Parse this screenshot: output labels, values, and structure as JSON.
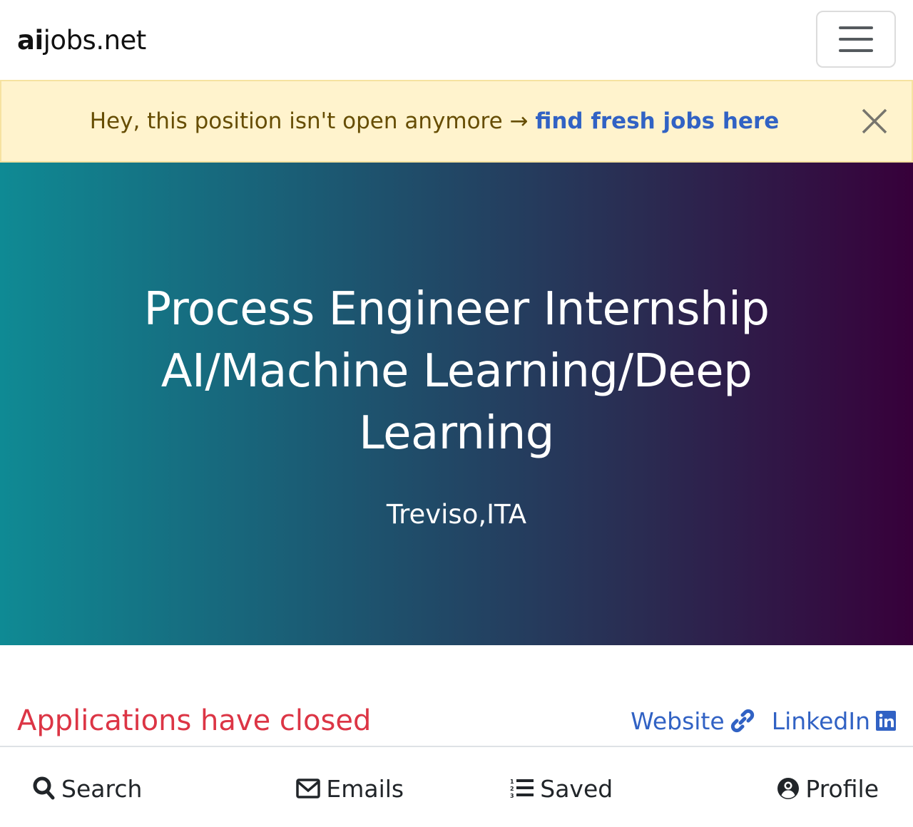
{
  "navbar": {
    "brand_bold": "ai",
    "brand_rest": "jobs.net",
    "menu_toggle_icon": "hamburger-menu-icon"
  },
  "alert": {
    "message": "Hey, this position isn't open anymore → ",
    "link_label": "find fresh jobs here",
    "close_icon": "close-icon",
    "colors": {
      "background": "#fff3cd",
      "text": "#664d03",
      "link": "#3162c4"
    }
  },
  "hero": {
    "title": "Process Engineer Internship AI/Machine Learning/Deep Learning",
    "location": "Treviso,ITA",
    "gradient": {
      "start": "#0f8a94",
      "end": "#37003a"
    }
  },
  "status": {
    "text": "Applications have closed",
    "color": "#dc3545"
  },
  "links": [
    {
      "label": "Website",
      "icon": "link-icon"
    },
    {
      "label": "LinkedIn",
      "icon": "linkedin-icon"
    }
  ],
  "bottom_nav": [
    {
      "label": "Search",
      "icon": "search-icon"
    },
    {
      "label": "Emails",
      "icon": "envelope-icon"
    },
    {
      "label": "Saved",
      "icon": "numbered-list-icon"
    },
    {
      "label": "Profile",
      "icon": "user-circle-icon"
    }
  ]
}
